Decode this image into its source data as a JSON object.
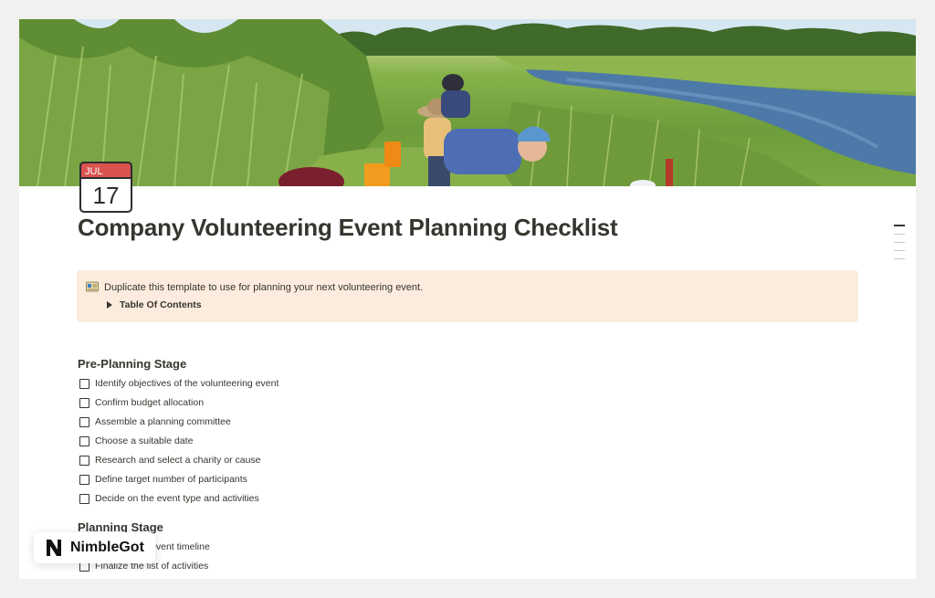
{
  "page": {
    "title": "Company Volunteering Event Planning Checklist",
    "cover_image": "volunteers-in-marsh-photo",
    "icon": {
      "name": "calendar-icon",
      "month": "JUL",
      "day": "17"
    }
  },
  "callout": {
    "icon": "card-index-icon",
    "text": "Duplicate this template to use for planning your next volunteering event.",
    "toggle_label": "Table Of Contents"
  },
  "sections": [
    {
      "heading": "Pre-Planning Stage",
      "items": [
        {
          "label": "Identify objectives of the volunteering event",
          "checked": false
        },
        {
          "label": "Confirm budget allocation",
          "checked": false
        },
        {
          "label": "Assemble a planning committee",
          "checked": false
        },
        {
          "label": "Choose a suitable date",
          "checked": false
        },
        {
          "label": "Research and select a charity or cause",
          "checked": false
        },
        {
          "label": "Define target number of participants",
          "checked": false
        },
        {
          "label": "Decide on the event type and activities",
          "checked": false
        }
      ]
    },
    {
      "heading": "Planning Stage",
      "items": [
        {
          "label": "tailed event timeline",
          "checked": false
        },
        {
          "label": "Finalize the list of activities",
          "checked": false
        }
      ]
    }
  ],
  "badge": {
    "logo": "nimblegot-n-logo",
    "text": "NimbleGot"
  },
  "colors": {
    "text": "#37352f",
    "callout_bg": "#fbecdd",
    "page_bg": "#ffffff",
    "outer_bg": "#f1f1f0"
  }
}
